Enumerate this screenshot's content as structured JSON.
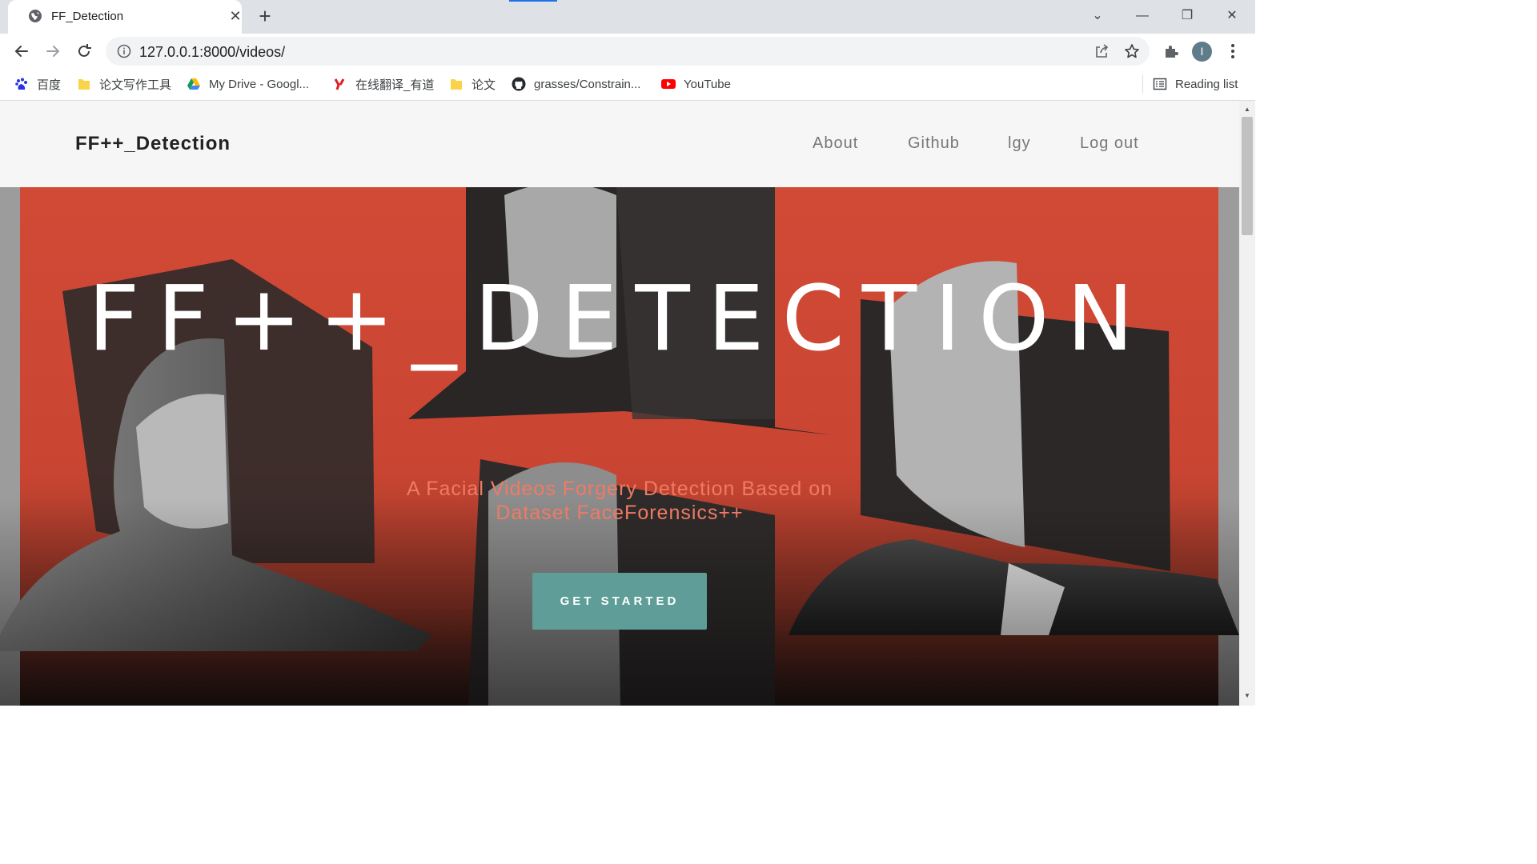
{
  "tab": {
    "title": "FF_Detection",
    "close_glyph": "✕",
    "icon": "globe-icon"
  },
  "new_tab_glyph": "+",
  "window_controls": {
    "chevron": "⌄",
    "minimize": "—",
    "restore": "❐",
    "close": "✕"
  },
  "toolbar": {
    "url": "127.0.0.1:8000/videos/",
    "profile_initial": "I"
  },
  "bookmarks": [
    {
      "label": "百度",
      "icon": "baidu-icon"
    },
    {
      "label": "论文写作工具",
      "icon": "folder-icon"
    },
    {
      "label": "My Drive - Googl...",
      "icon": "google-drive-icon"
    },
    {
      "label": "在线翻译_有道",
      "icon": "youdao-icon"
    },
    {
      "label": "论文",
      "icon": "folder-icon"
    },
    {
      "label": "grasses/Constrain...",
      "icon": "github-icon"
    },
    {
      "label": "YouTube",
      "icon": "youtube-icon"
    }
  ],
  "reading_list": "Reading list",
  "site": {
    "brand": "FF++_Detection",
    "nav": [
      "About",
      "Github",
      "lgy",
      "Log out"
    ]
  },
  "hero": {
    "title": "FF++_DETECTION",
    "subtitle": "A Facial Videos Forgery Detection Based on Dataset FaceForensics++",
    "cta": "GET STARTED"
  },
  "colors": {
    "hero_red": "#d14a36",
    "cta_teal": "#5f9e98",
    "subtitle_salmon": "#f07a64",
    "loading_blue": "#1a73e8"
  }
}
